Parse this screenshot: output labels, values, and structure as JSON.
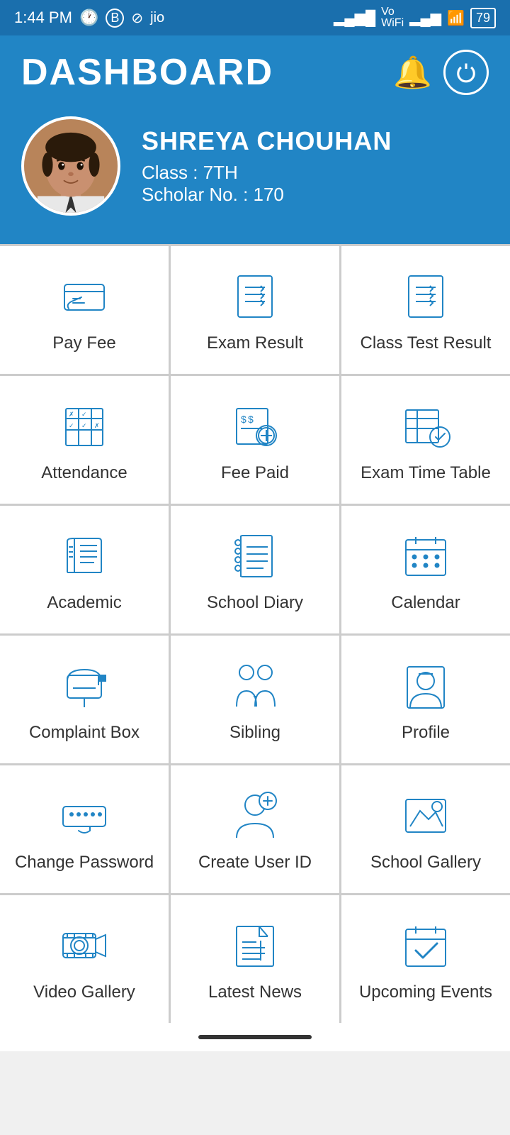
{
  "statusBar": {
    "time": "1:44 PM",
    "battery": "79"
  },
  "header": {
    "title": "DASHBOARD"
  },
  "profile": {
    "name": "SHREYA  CHOUHAN",
    "class_label": "Class : 7TH",
    "scholar_label": "Scholar No. : 170"
  },
  "grid": {
    "items": [
      {
        "id": "pay-fee",
        "label": "Pay Fee",
        "icon": "pay-fee-icon"
      },
      {
        "id": "exam-result",
        "label": "Exam Result",
        "icon": "exam-result-icon"
      },
      {
        "id": "class-test",
        "label": "Class Test Result",
        "icon": "class-test-icon"
      },
      {
        "id": "attendance",
        "label": "Attendance",
        "icon": "attendance-icon"
      },
      {
        "id": "fee-paid",
        "label": "Fee Paid",
        "icon": "fee-paid-icon"
      },
      {
        "id": "exam-timetable",
        "label": "Exam Time Table",
        "icon": "exam-timetable-icon"
      },
      {
        "id": "academic",
        "label": "Academic",
        "icon": "academic-icon"
      },
      {
        "id": "school-diary",
        "label": "School Diary",
        "icon": "school-diary-icon"
      },
      {
        "id": "calendar",
        "label": "Calendar",
        "icon": "calendar-icon"
      },
      {
        "id": "complaint-box",
        "label": "Complaint Box",
        "icon": "complaint-box-icon"
      },
      {
        "id": "sibling",
        "label": "Sibling",
        "icon": "sibling-icon"
      },
      {
        "id": "profile",
        "label": "Profile",
        "icon": "profile-icon"
      },
      {
        "id": "change-password",
        "label": "Change Password",
        "icon": "change-password-icon"
      },
      {
        "id": "create-user-id",
        "label": "Create User ID",
        "icon": "create-user-id-icon"
      },
      {
        "id": "school-gallery",
        "label": "School Gallery",
        "icon": "school-gallery-icon"
      },
      {
        "id": "video-gallery",
        "label": "Video Gallery",
        "icon": "video-gallery-icon"
      },
      {
        "id": "latest-news",
        "label": "Latest News",
        "icon": "latest-news-icon"
      },
      {
        "id": "upcoming-events",
        "label": "Upcoming Events",
        "icon": "upcoming-events-icon"
      }
    ]
  },
  "colors": {
    "accent": "#2185c5",
    "header_bg": "#2185c5"
  }
}
